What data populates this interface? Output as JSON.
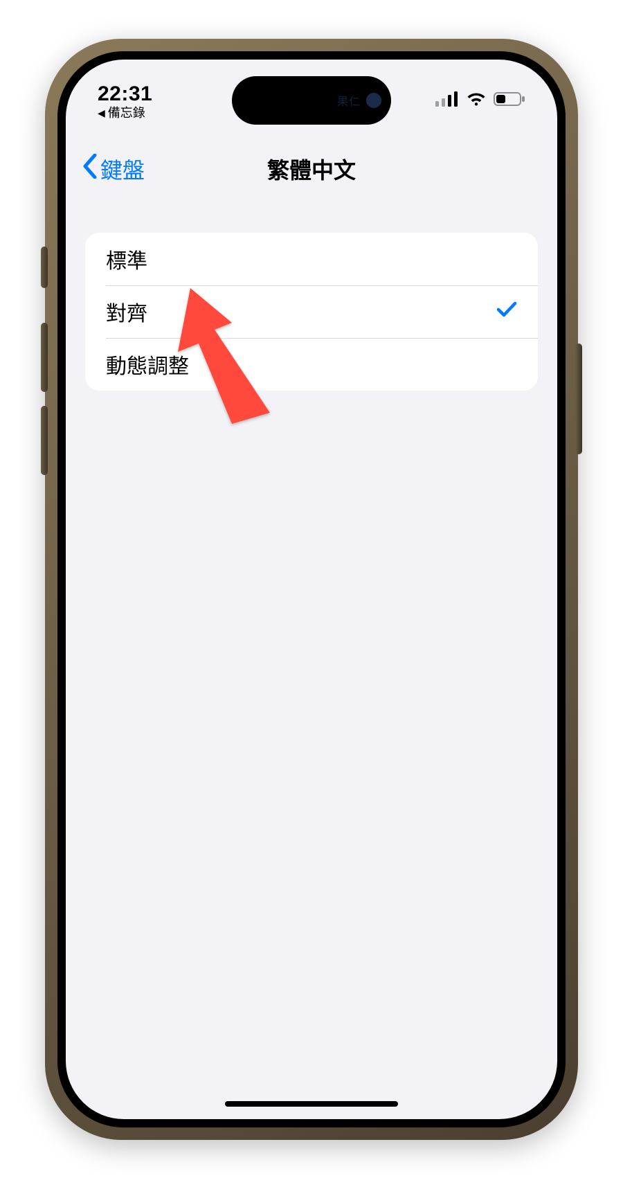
{
  "statusbar": {
    "time": "22:31",
    "breadcrumb_app": "備忘錄",
    "island_text": "果仁"
  },
  "nav": {
    "back_label": "鍵盤",
    "title": "繁體中文"
  },
  "options": [
    {
      "label": "標準",
      "selected": false
    },
    {
      "label": "對齊",
      "selected": true
    },
    {
      "label": "動態調整",
      "selected": false
    }
  ],
  "annotation": {
    "arrow_color": "#ff4a3d",
    "target_option_index": 1
  },
  "colors": {
    "accent": "#007aff",
    "bg": "#f2f2f7",
    "card": "#ffffff"
  }
}
